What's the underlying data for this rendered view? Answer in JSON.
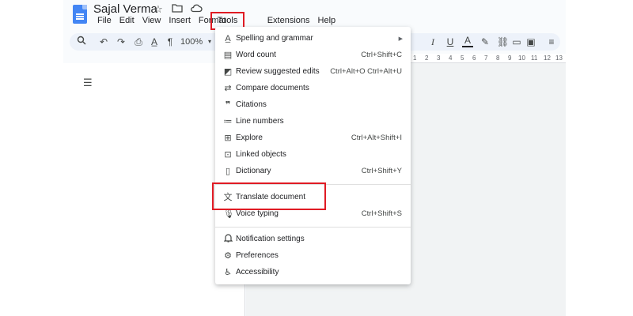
{
  "document": {
    "title": "Sajal Verma"
  },
  "menubar": [
    "File",
    "Edit",
    "View",
    "Insert",
    "Format",
    "Tools",
    "Extensions",
    "Help"
  ],
  "toolbar": {
    "zoom": "100%"
  },
  "ruler_ticks": [
    "1",
    "2",
    "3",
    "4",
    "5",
    "6",
    "7",
    "8",
    "9",
    "10",
    "11",
    "12",
    "13"
  ],
  "tools_menu": {
    "items": [
      {
        "label": "Spelling and grammar",
        "icon": "spellcheck-icon",
        "submenu": true
      },
      {
        "label": "Word count",
        "icon": "word-count-icon",
        "shortcut": "Ctrl+Shift+C"
      },
      {
        "label": "Review suggested edits",
        "icon": "review-edits-icon",
        "shortcut": "Ctrl+Alt+O Ctrl+Alt+U"
      },
      {
        "label": "Compare documents",
        "icon": "compare-icon"
      },
      {
        "label": "Citations",
        "icon": "quote-icon"
      },
      {
        "label": "Line numbers",
        "icon": "line-numbers-icon"
      },
      {
        "label": "Explore",
        "icon": "explore-icon",
        "shortcut": "Ctrl+Alt+Shift+I"
      },
      {
        "label": "Linked objects",
        "icon": "linked-objects-icon"
      },
      {
        "label": "Dictionary",
        "icon": "dictionary-icon",
        "shortcut": "Ctrl+Shift+Y"
      },
      {
        "label": "Translate document",
        "icon": "translate-icon"
      },
      {
        "label": "Voice typing",
        "icon": "microphone-icon",
        "shortcut": "Ctrl+Shift+S"
      },
      {
        "label": "Notification settings",
        "icon": "bell-icon"
      },
      {
        "label": "Preferences",
        "icon": "preferences-icon"
      },
      {
        "label": "Accessibility",
        "icon": "accessibility-icon"
      }
    ]
  },
  "colors": {
    "highlight": "#e01b24",
    "docs_blue": "#4285f4",
    "toolbar_bg": "#edf2fa"
  }
}
